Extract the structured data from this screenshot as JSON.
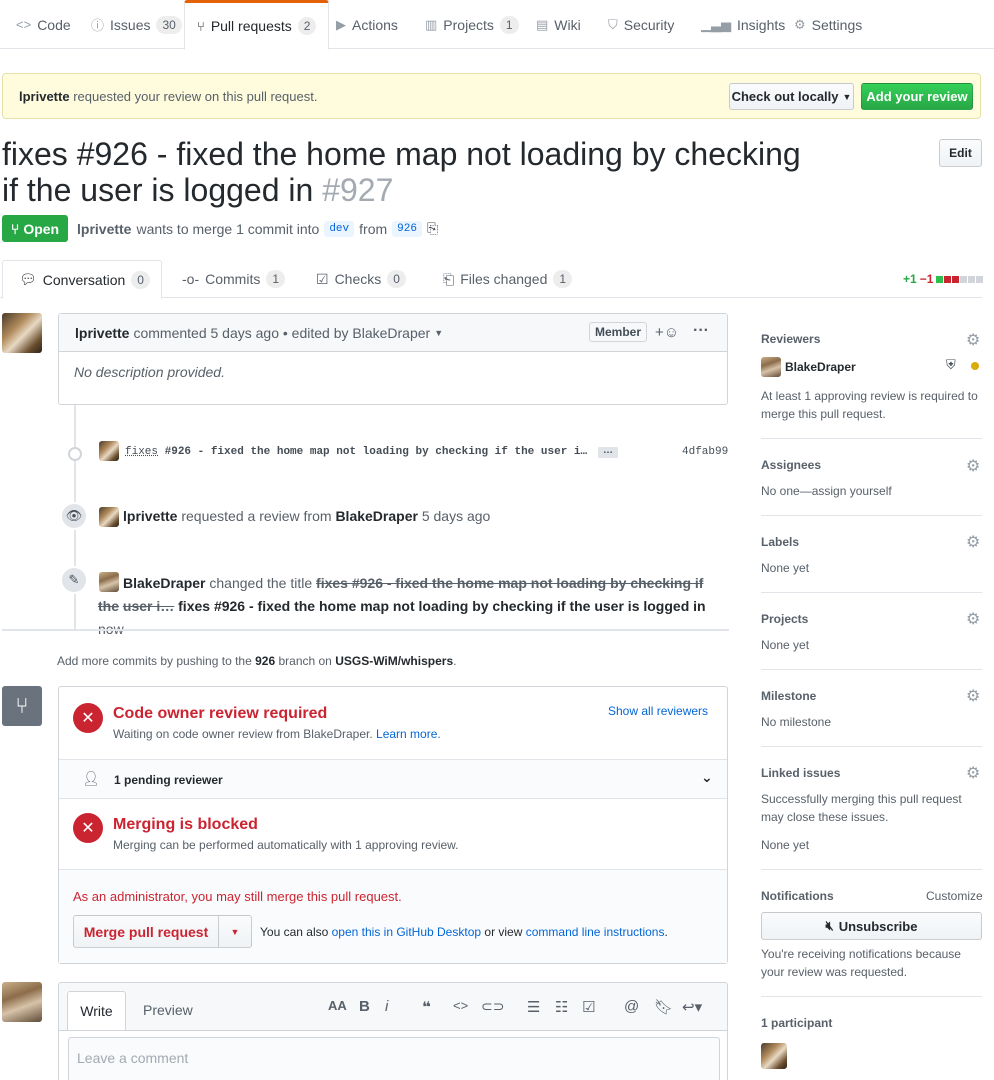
{
  "topnav": {
    "code": "Code",
    "issues": "Issues",
    "issues_count": "30",
    "pulls": "Pull requests",
    "pulls_count": "2",
    "actions": "Actions",
    "projects": "Projects",
    "projects_count": "1",
    "wiki": "Wiki",
    "security": "Security",
    "insights": "Insights",
    "settings": "Settings"
  },
  "banner": {
    "user": "lprivette",
    "text": "requested your review on this pull request.",
    "checkout": "Check out locally",
    "add_review": "Add your review"
  },
  "pr": {
    "title_line1": "fixes #926 - fixed the home map not loading by checking",
    "title_line2": "if the user is logged in",
    "number": "#927",
    "edit": "Edit",
    "state": "Open",
    "author": "lprivette",
    "merge_text1": "wants to merge 1 commit into",
    "base": "dev",
    "merge_text2": "from",
    "head": "926"
  },
  "prtabs": {
    "conversation": "Conversation",
    "conversation_count": "0",
    "commits": "Commits",
    "commits_count": "1",
    "checks": "Checks",
    "checks_count": "0",
    "files": "Files changed",
    "files_count": "1",
    "additions": "+1",
    "deletions": "−1"
  },
  "comment": {
    "author": "lprivette",
    "meta": "commented 5 days ago • edited by BlakeDraper",
    "role": "Member",
    "body": "No description provided."
  },
  "timeline": {
    "commit_link": "fixes",
    "commit_msg": "#926 - fixed the home map not loading by checking if the user i…",
    "commit_ellipsis": "…",
    "commit_sha": "4dfab99",
    "review_user": "lprivette",
    "review_text": "requested a review from",
    "review_target": "BlakeDraper",
    "review_time": "5 days ago",
    "rename_user": "BlakeDraper",
    "rename_text": "changed the title",
    "old_title_1": "fixes #926 - fixed the home map not loading by checking if the",
    "old_title_2": "user i…",
    "new_title": "fixes #926 - fixed the home map not loading by checking if the user is logged in",
    "rename_time": "now"
  },
  "merge_hint": {
    "pre": "Add more commits by pushing to the",
    "branch": "926",
    "mid": "branch on",
    "repo": "USGS-WiM/whispers",
    "end": "."
  },
  "merge_box": {
    "codeowner_title": "Code owner review required",
    "codeowner_text": "Waiting on code owner review from BlakeDraper.",
    "learn_more": "Learn more.",
    "show_all": "Show all reviewers",
    "pending": "1 pending reviewer",
    "blocked_title": "Merging is blocked",
    "blocked_text": "Merging can be performed automatically with 1 approving review.",
    "admin_text": "As an administrator, you may still merge this pull request.",
    "merge_button": "Merge pull request",
    "also_text": "You can also",
    "desktop_link": "open this in GitHub Desktop",
    "or_view": "or view",
    "cli_link": "command line instructions",
    "period": "."
  },
  "editor": {
    "write": "Write",
    "preview": "Preview",
    "placeholder": "Leave a comment"
  },
  "sidebar": {
    "reviewers_label": "Reviewers",
    "reviewer_name": "BlakeDraper",
    "reviewers_note": "At least 1 approving review is required to merge this pull request.",
    "assignees_label": "Assignees",
    "assignees_val": "No one—assign yourself",
    "labels_label": "Labels",
    "labels_val": "None yet",
    "projects_label": "Projects",
    "projects_val": "None yet",
    "milestone_label": "Milestone",
    "milestone_val": "No milestone",
    "linked_label": "Linked issues",
    "linked_note": "Successfully merging this pull request may close these issues.",
    "linked_val": "None yet",
    "notifications_label": "Notifications",
    "customize": "Customize",
    "unsubscribe": "Unsubscribe",
    "notif_note": "You're receiving notifications because your review was requested.",
    "participants": "1 participant"
  },
  "colors": {
    "accent": "#0366d6",
    "success": "#28a745",
    "danger": "#cb2431",
    "active_tab": "#e36209",
    "pending_dot": "#dbab09"
  }
}
